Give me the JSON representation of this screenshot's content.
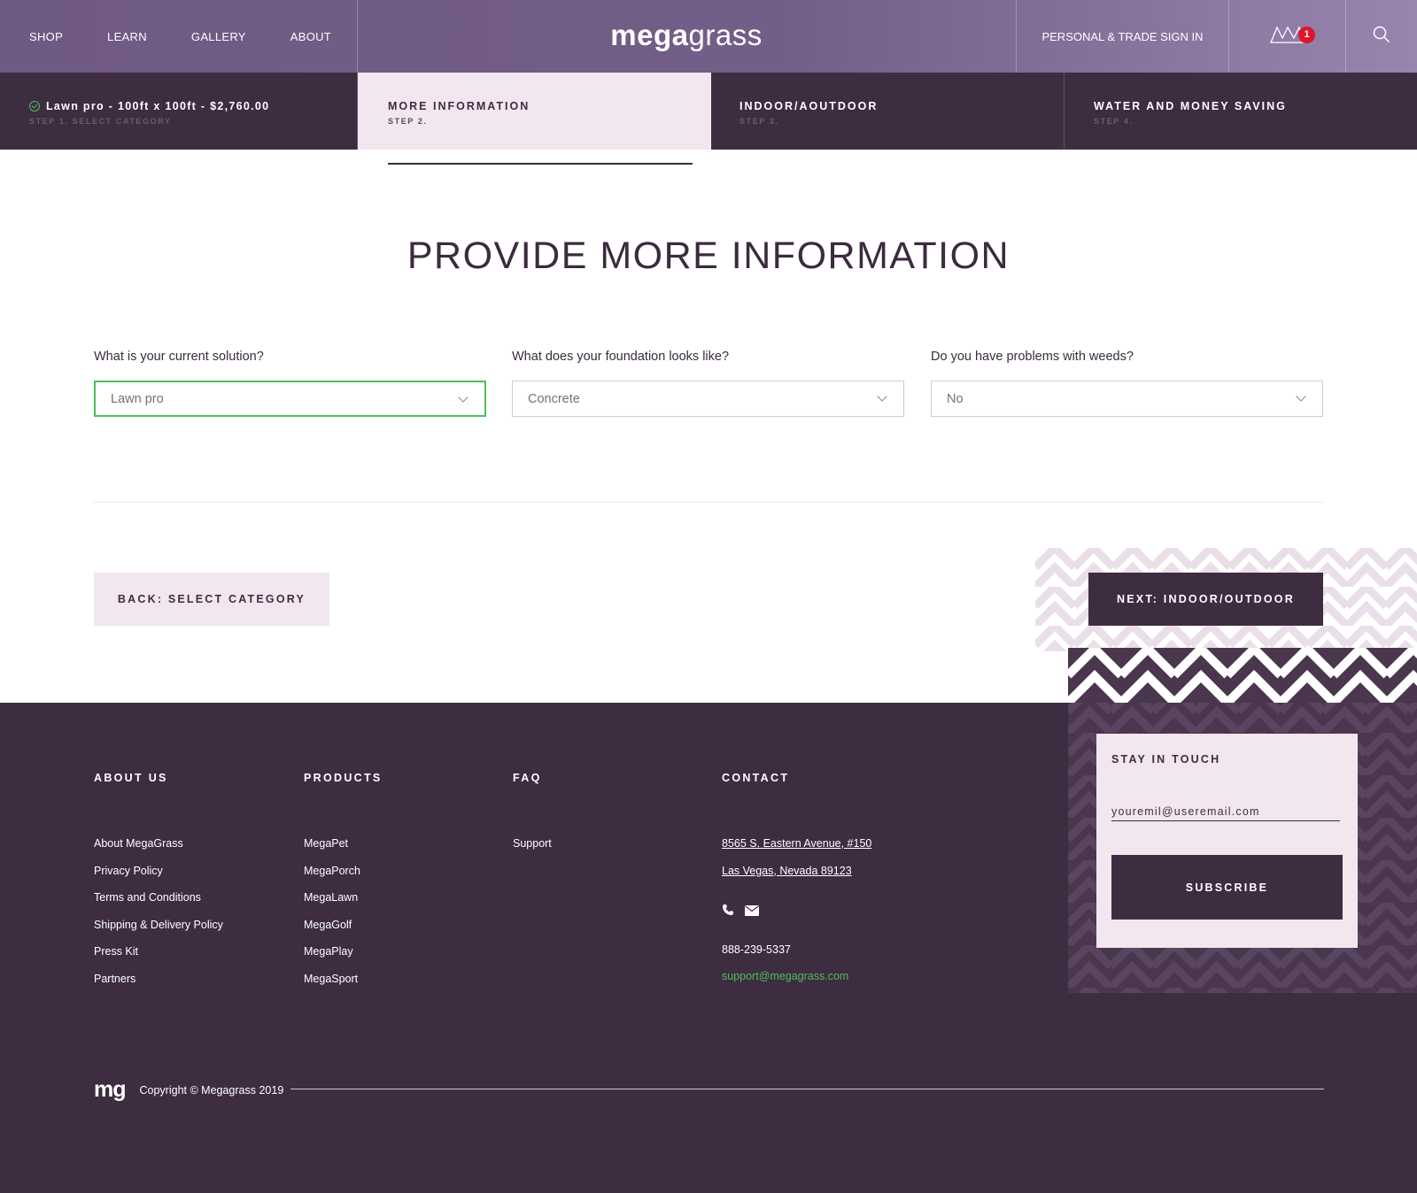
{
  "header": {
    "nav": [
      "SHOP",
      "LEARN",
      "GALLERY",
      "ABOUT"
    ],
    "logo_bold": "mega",
    "logo_light": "grass",
    "signin": "PERSONAL & TRADE SIGN IN",
    "cart_icon": "cart-icon",
    "cart_count": "1",
    "search_icon": "search-icon"
  },
  "steps": [
    {
      "title": "Lawn pro - 100ft x 100ft - $2,760.00",
      "sub": "STEP 1. SELECT CATEGORY",
      "completed": true
    },
    {
      "title": "MORE INFORMATION",
      "sub": "STEP 2.",
      "active": true
    },
    {
      "title": "INDOOR/AOUTDOOR",
      "sub": "STEP 3."
    },
    {
      "title": "WATER AND MONEY SAVING",
      "sub": "STEP 4."
    }
  ],
  "main": {
    "title": "PROVIDE MORE INFORMATION",
    "fields": [
      {
        "label": "What is your current solution?",
        "value": "Lawn pro"
      },
      {
        "label": "What does your foundation looks like?",
        "value": "Concrete"
      },
      {
        "label": "Do you have problems with weeds?",
        "value": "No"
      }
    ],
    "back_label": "BACK: SELECT CATEGORY",
    "next_label": "NEXT: INDOOR/OUTDOOR"
  },
  "footer": {
    "about": {
      "heading": "ABOUT US",
      "links": [
        "About MegaGrass",
        "Privacy Policy",
        "Terms and Conditions",
        "Shipping & Delivery Policy",
        "Press Kit",
        "Partners"
      ]
    },
    "products": {
      "heading": "PRODUCTS",
      "links": [
        "MegaPet",
        "MegaPorch",
        "MegaLawn",
        "MegaGolf",
        "MegaPlay",
        "MegaSport"
      ]
    },
    "faq": {
      "heading": "FAQ",
      "links": [
        "Support"
      ]
    },
    "contact": {
      "heading": "CONTACT",
      "address1": "8565 S. Eastern Avenue, #150",
      "address2": "Las Vegas, Nevada 89123",
      "phone": "888-239-5337",
      "email": "support@megagrass.com"
    },
    "stay": {
      "heading": "STAY IN TOUCH",
      "placeholder": "youremil@useremail.com",
      "button": "SUBSCRIBE"
    },
    "mark": "mg",
    "copyright": "Copyright © Megagrass 2019"
  },
  "colors": {
    "header_bg": "#735e88",
    "dark": "#3e2c41",
    "light": "#f2e6ef",
    "accent_green": "#4bbf5c",
    "badge_red": "#e0142a"
  }
}
